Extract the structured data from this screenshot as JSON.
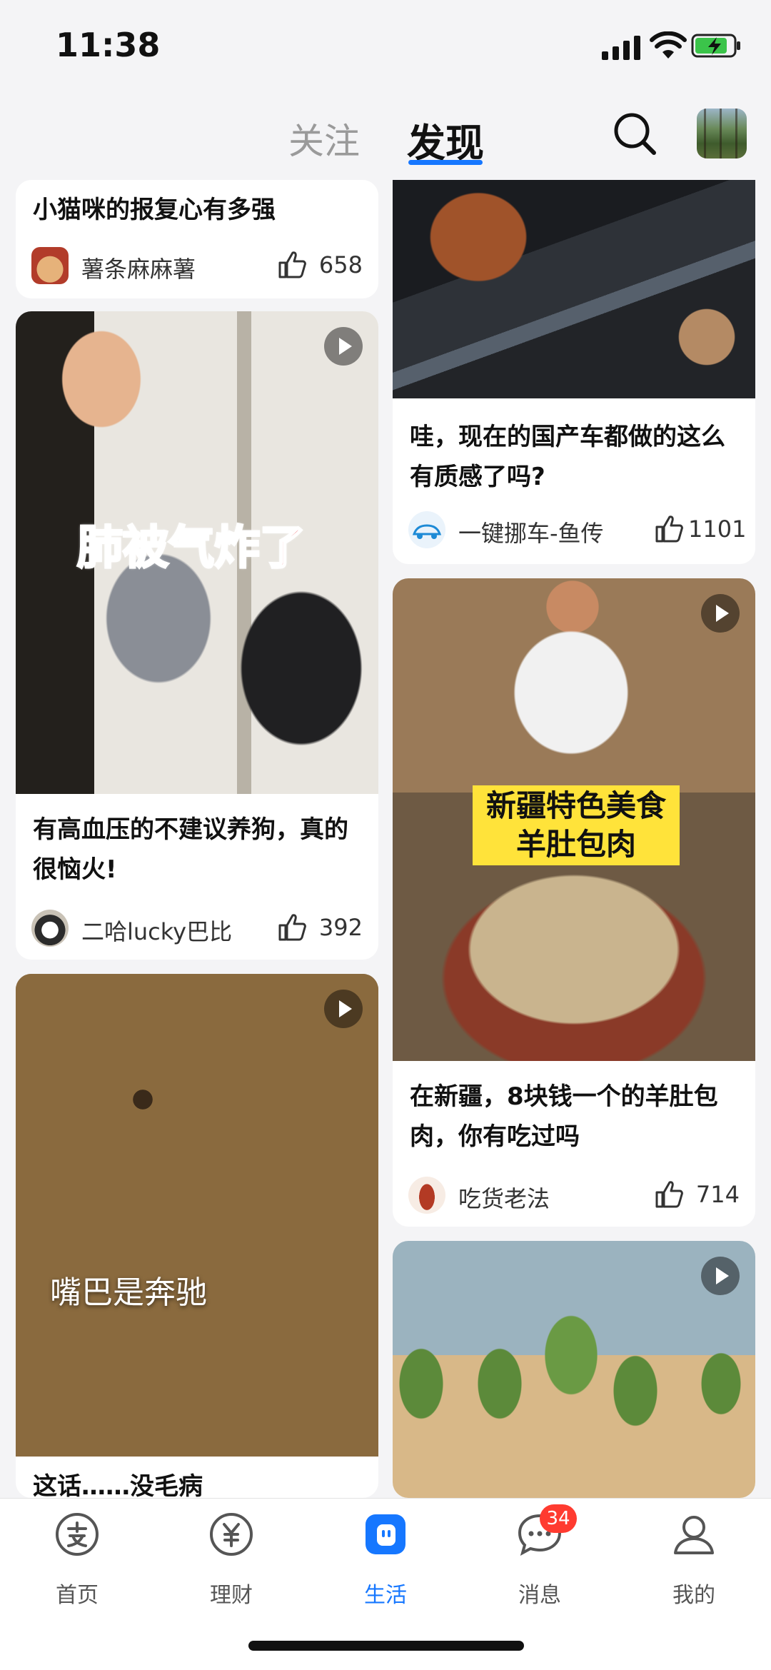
{
  "status": {
    "time": "11:38"
  },
  "topnav": {
    "follow": "关注",
    "discover": "发现"
  },
  "cards": [
    {
      "title": "小猫咪的报复心有多强",
      "author": "薯条麻麻薯",
      "likes": "658"
    },
    {
      "overlay": "肺被气炸了",
      "title": "有高血压的不建议养狗，真的很恼火!",
      "author": "二哈lucky巴比",
      "likes": "392"
    },
    {
      "overlay": "嘴巴是奔驰",
      "title": "这话……没毛病"
    },
    {
      "title": "哇，现在的国产车都做的这么有质感了吗?",
      "author": "一键挪车-鱼传",
      "likes": "1101"
    },
    {
      "overlay_line1": "新疆特色美食",
      "overlay_line2": "羊肚包肉",
      "title": "在新疆，8块钱一个的羊肚包肉，你有吃过吗",
      "author": "吃货老法",
      "likes": "714"
    },
    {
      "title": ""
    }
  ],
  "tabbar": {
    "home": "首页",
    "finance": "理财",
    "life": "生活",
    "messages": "消息",
    "messages_badge": "34",
    "me": "我的"
  },
  "colors": {
    "accent": "#1677ff",
    "badge": "#ff3b30"
  }
}
